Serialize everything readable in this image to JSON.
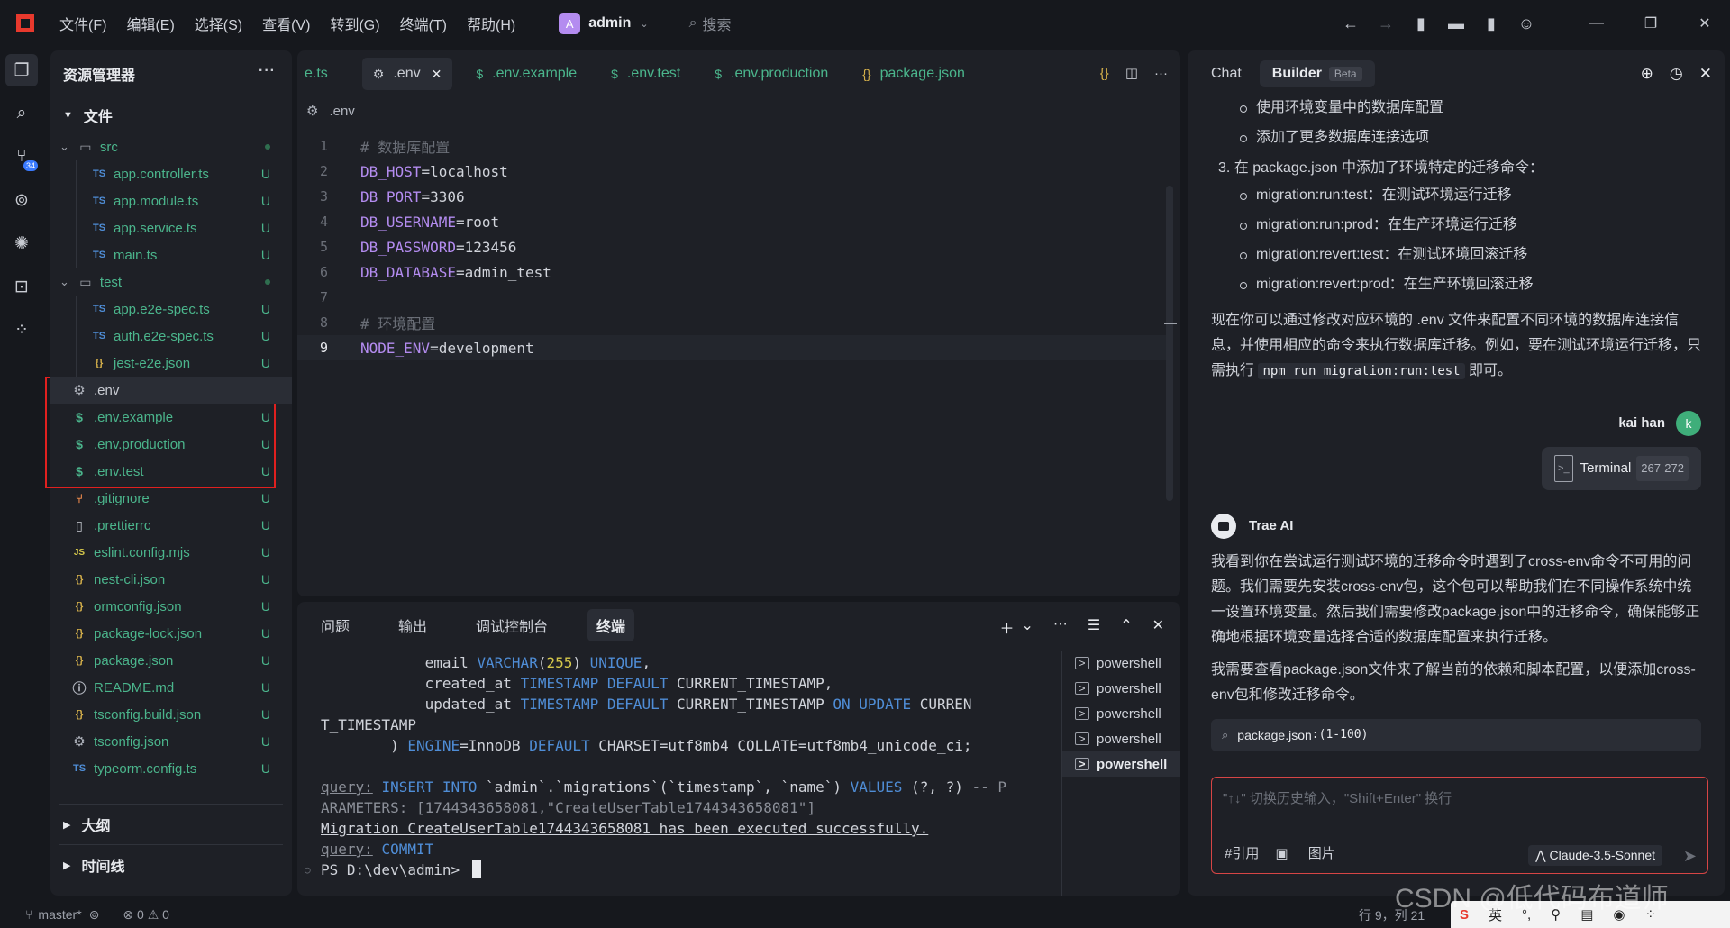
{
  "menu": [
    "文件(F)",
    "编辑(E)",
    "选择(S)",
    "查看(V)",
    "转到(G)",
    "终端(T)",
    "帮助(H)"
  ],
  "workspace": {
    "avatar": "A",
    "name": "admin"
  },
  "search": {
    "placeholder": "搜索"
  },
  "activity_badge": "34",
  "explorer": {
    "title": "资源管理器",
    "section": "文件",
    "tree": [
      {
        "name": "src",
        "type": "folder",
        "depth": 0,
        "status": ""
      },
      {
        "name": "app.controller.ts",
        "icon": "TS",
        "depth": 1,
        "status": "U"
      },
      {
        "name": "app.module.ts",
        "icon": "TS",
        "depth": 1,
        "status": "U"
      },
      {
        "name": "app.service.ts",
        "icon": "TS",
        "depth": 1,
        "status": "U"
      },
      {
        "name": "main.ts",
        "icon": "TS",
        "depth": 1,
        "status": "U"
      },
      {
        "name": "test",
        "type": "folder",
        "depth": 0,
        "status": ""
      },
      {
        "name": "app.e2e-spec.ts",
        "icon": "TS",
        "depth": 1,
        "status": "U"
      },
      {
        "name": "auth.e2e-spec.ts",
        "icon": "TS",
        "depth": 1,
        "status": "U"
      },
      {
        "name": "jest-e2e.json",
        "icon": "{}",
        "depth": 1,
        "status": "U"
      },
      {
        "name": ".env",
        "icon": "gear",
        "depth": 0,
        "status": "",
        "selected": true
      },
      {
        "name": ".env.example",
        "icon": "$",
        "depth": 0,
        "status": "U"
      },
      {
        "name": ".env.production",
        "icon": "$",
        "depth": 0,
        "status": "U"
      },
      {
        "name": ".env.test",
        "icon": "$",
        "depth": 0,
        "status": "U"
      },
      {
        "name": ".gitignore",
        "icon": "git",
        "depth": 0,
        "status": "U"
      },
      {
        "name": ".prettierrc",
        "icon": "file",
        "depth": 0,
        "status": "U"
      },
      {
        "name": "eslint.config.mjs",
        "icon": "JS",
        "depth": 0,
        "status": "U"
      },
      {
        "name": "nest-cli.json",
        "icon": "{}",
        "depth": 0,
        "status": "U"
      },
      {
        "name": "ormconfig.json",
        "icon": "{}",
        "depth": 0,
        "status": "U"
      },
      {
        "name": "package-lock.json",
        "icon": "{}",
        "depth": 0,
        "status": "U"
      },
      {
        "name": "package.json",
        "icon": "{}",
        "depth": 0,
        "status": "U"
      },
      {
        "name": "README.md",
        "icon": "info",
        "depth": 0,
        "status": "U"
      },
      {
        "name": "tsconfig.build.json",
        "icon": "{}",
        "depth": 0,
        "status": "U"
      },
      {
        "name": "tsconfig.json",
        "icon": "gear",
        "depth": 0,
        "status": "U"
      },
      {
        "name": "typeorm.config.ts",
        "icon": "TS",
        "depth": 0,
        "status": "U"
      }
    ],
    "outline": "大纲",
    "timeline": "时间线"
  },
  "tabs": [
    {
      "label": "e.ts",
      "icon": "",
      "active": false
    },
    {
      "label": ".env",
      "icon": "gear",
      "active": true
    },
    {
      "label": ".env.example",
      "icon": "$",
      "active": false
    },
    {
      "label": ".env.test",
      "icon": "$",
      "active": false
    },
    {
      "label": ".env.production",
      "icon": "$",
      "active": false
    },
    {
      "label": "package.json",
      "icon": "{}",
      "active": false
    }
  ],
  "breadcrumb": ".env",
  "code": [
    {
      "n": "1",
      "comment": "# 数据库配置"
    },
    {
      "n": "2",
      "key": "DB_HOST",
      "val": "localhost"
    },
    {
      "n": "3",
      "key": "DB_PORT",
      "val": "3306"
    },
    {
      "n": "4",
      "key": "DB_USERNAME",
      "val": "root"
    },
    {
      "n": "5",
      "key": "DB_PASSWORD",
      "val": "123456"
    },
    {
      "n": "6",
      "key": "DB_DATABASE",
      "val": "admin_test"
    },
    {
      "n": "7"
    },
    {
      "n": "8",
      "comment": "# 环境配置"
    },
    {
      "n": "9",
      "key": "NODE_ENV",
      "val": "development",
      "current": true
    }
  ],
  "panel": {
    "tabs": [
      "问题",
      "输出",
      "调试控制台",
      "终端"
    ],
    "terminals": [
      "powershell",
      "powershell",
      "powershell",
      "powershell",
      "powershell"
    ],
    "prompt": "PS D:\\dev\\admin> "
  },
  "chat": {
    "tab_chat": "Chat",
    "tab_builder": "Builder",
    "beta": "Beta",
    "bullets_top": [
      "使用环境变量中的数据库配置",
      "添加了更多数据库连接选项"
    ],
    "item3": "3. 在 package.json 中添加了环境特定的迁移命令：",
    "bullets_mid": [
      "migration:run:test：在测试环境运行迁移",
      "migration:run:prod：在生产环境运行迁移",
      "migration:revert:test：在测试环境回滚迁移",
      "migration:revert:prod：在生产环境回滚迁移"
    ],
    "para1_a": "现在你可以通过修改对应环境的 .env 文件来配置不同环境的数据库连接信息，并使用相应的命令来执行数据库迁移。例如，要在测试环境运行迁移，只需执行 ",
    "para1_code": "npm run migration:run:test",
    "para1_b": " 即可。",
    "user_name": "kai han",
    "user_avatar": "k",
    "user_msg": "Terminal",
    "user_msg_range": "267-272",
    "ai_name": "Trae AI",
    "ai_para1": "我看到你在尝试运行测试环境的迁移命令时遇到了cross-env命令不可用的问题。我们需要先安装cross-env包，这个包可以帮助我们在不同操作系统中统一设置环境变量。然后我们需要修改package.json中的迁移命令，确保能够正确地根据环境变量选择合适的数据库配置来执行迁移。",
    "ai_para2": "我需要查看package.json文件来了解当前的依赖和脚本配置，以便添加cross-env包和修改迁移命令。",
    "file_ref": "package.json",
    "file_ref_range": ":(1-100)",
    "input_placeholder": "\"↑↓\" 切换历史输入，\"Shift+Enter\" 换行",
    "ref_label": "#引用",
    "image_label": "图片",
    "model": "Claude-3.5-Sonnet"
  },
  "status": {
    "branch": "master*",
    "errors": "0",
    "warnings": "0",
    "cursor": "行 9，列 21"
  },
  "tray": [
    "英"
  ],
  "watermark": "CSDN @低代码布道师"
}
